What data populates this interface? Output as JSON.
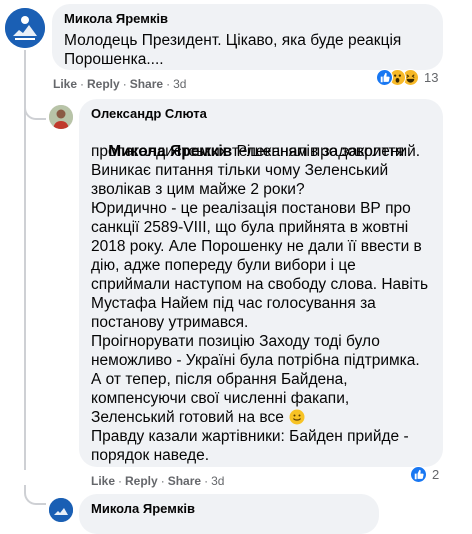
{
  "comment1": {
    "author": "Микола Яремків",
    "text": "Молодець Президент. Цікаво, яка буде реакція\nПорошенка....",
    "actions": {
      "like": "Like",
      "reply": "Reply",
      "share": "Share",
      "time": "3d"
    },
    "reactions": {
      "count": "13",
      "icons": [
        "like-reaction-icon",
        "wow-reaction-icon",
        "haha-reaction-icon"
      ]
    }
  },
  "reply1": {
    "author": "Олександр Слюта",
    "mention": "Микола Яремків",
    "first_line_rest": " Рішенням про закриття",
    "text": "пропагандистських телеканалів задоволений.\nВиникає питання тільки чому Зеленський\nзволікав з цим майже 2 роки?\nЮридично - це реалізація постанови ВР про\nсанкції 2589-VIII, що була прийнята в жовтні\n2018 року. Але Порошенку не дали її ввести в\nдію, адже попереду були вибори і це\nсприймали наступом на свободу слова. Навіть\nМустафа Найем під час голосування за\nпостанову утримався.\nПроігнорувати позицію Заходу тоді було\nнеможливо - Україні була потрібна підтримка.\nА от тепер, після обрання Байдена,\nкомпенсуючи свої численні факапи,\nЗеленський готовий на все",
    "emoji": "smile-emoji-icon",
    "closing": "Правду казали жартівники: Байден прийде -\nпорядок наведе.",
    "actions": {
      "like": "Like",
      "reply": "Reply",
      "share": "Share",
      "time": "3d"
    },
    "reactions": {
      "count": "2",
      "icons": [
        "like-reaction-icon"
      ]
    }
  },
  "reply2": {
    "author": "Микола Яремків"
  },
  "colors": {
    "bubble": "#f0f2f5",
    "meta": "#65676b",
    "like_blue": "#1877f2",
    "avatar_blue": "#1a5fb4"
  }
}
